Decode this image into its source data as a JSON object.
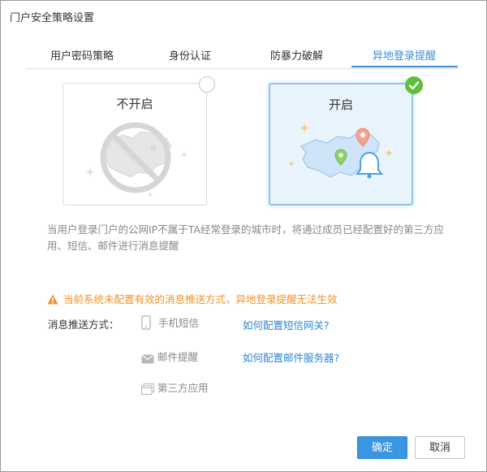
{
  "dialog": {
    "title": "门户安全策略设置"
  },
  "tabs": [
    {
      "label": "用户密码策略"
    },
    {
      "label": "身份认证"
    },
    {
      "label": "防暴力破解"
    },
    {
      "label": "异地登录提醒"
    }
  ],
  "active_tab": "异地登录提醒",
  "options": {
    "off": {
      "label": "不开启",
      "selected": false
    },
    "on": {
      "label": "开启",
      "selected": true
    }
  },
  "description": "当用户登录门户的公网IP不属于TA经常登录的城市时，将通过成员已经配置好的第三方应用、短信、邮件进行消息提醒",
  "warning": {
    "text": "当前系统未配置有效的消息推送方式，异地登录提醒无法生效",
    "color": "#f0932b"
  },
  "push": {
    "label": "消息推送方式：",
    "methods": [
      {
        "label": "手机短信",
        "icon": "phone-icon",
        "help": "如何配置短信网关?"
      },
      {
        "label": "邮件提醒",
        "icon": "mail-icon",
        "help": "如何配置邮件服务器?"
      },
      {
        "label": "第三方应用",
        "icon": "app-window-icon"
      }
    ]
  },
  "buttons": {
    "ok": "确定",
    "cancel": "取消"
  },
  "colors": {
    "accent": "#3b8fd6",
    "check": "#5fbf3a"
  }
}
